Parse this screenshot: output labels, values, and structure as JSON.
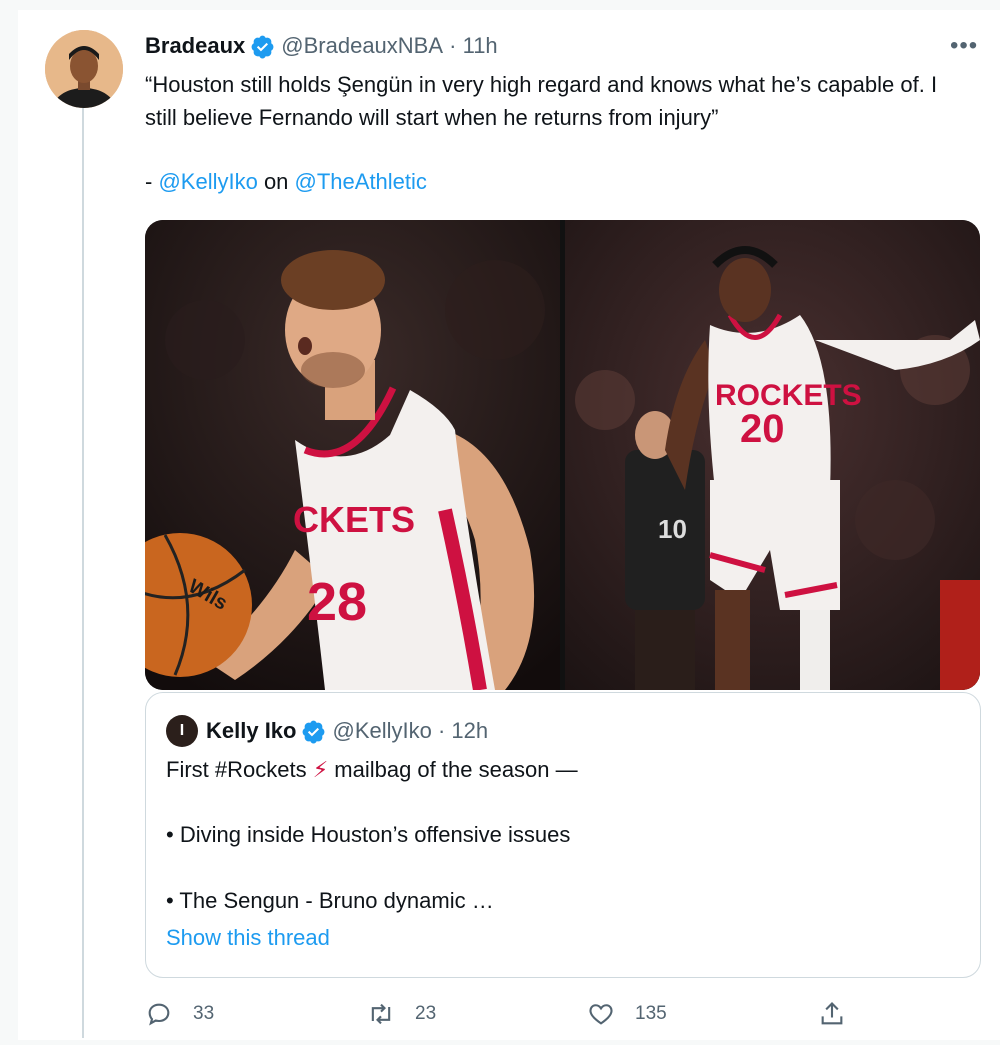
{
  "tweet": {
    "author_name": "Bradeaux",
    "author_handle": "@BradeauxNBA",
    "time": "11h",
    "text": "“Houston still holds Şengün in very high regard and knows what he’s capable of. I still believe Fernando will start when he returns from injury”",
    "attrib_dash": "- ",
    "attrib_mention1": "@KellyIko",
    "attrib_on": " on ",
    "attrib_mention2": "@TheAthletic",
    "more_label": "•••"
  },
  "photos": {
    "left_jersey_team": "CKETS",
    "left_jersey_number": "28",
    "right_jersey_team": "ROCKETS",
    "right_jersey_number": "20",
    "right_opponent_number": "10",
    "ball_brand": "Wils"
  },
  "quote": {
    "avatar_letter": "I",
    "author_name": "Kelly Iko",
    "author_handle": "@KellyIko",
    "time": "12h",
    "line1_pre": "First #Rockets ",
    "line1_glyph": "⚡",
    "line1_post": " mailbag of the season —",
    "bullet1": "• Diving inside Houston’s offensive issues",
    "bullet2": "• The Sengun - Bruno dynamic …",
    "show_thread": "Show this thread"
  },
  "actions": {
    "replies": "33",
    "retweets": "23",
    "likes": "135"
  },
  "colors": {
    "link": "#1d9bf0",
    "verified": "#1d9bf0",
    "rockets_red": "#ce1141",
    "muted": "#536471"
  }
}
